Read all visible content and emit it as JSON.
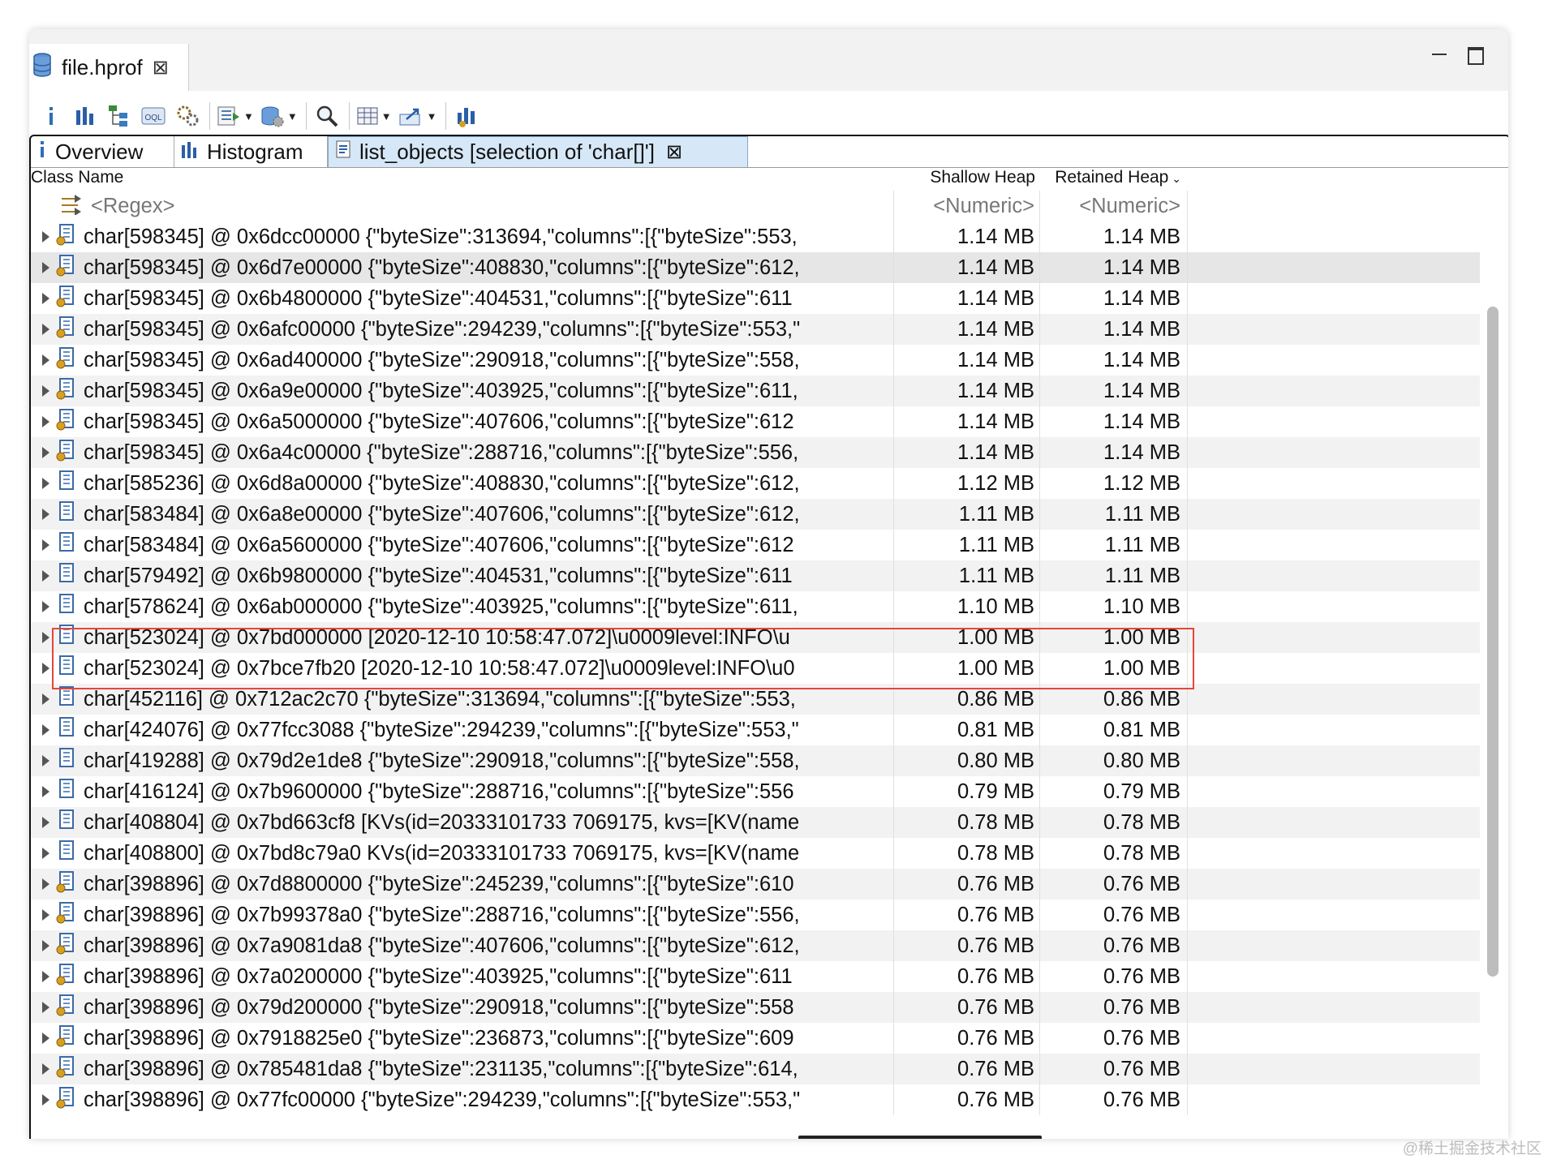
{
  "editor": {
    "tab_title": "file.hprof"
  },
  "toolbar": {
    "icons": [
      "info-icon",
      "histogram-icon",
      "dominator-tree-icon",
      "oql-icon",
      "thread-overview-icon",
      "run-report-icon",
      "query-browser-icon",
      "search-icon",
      "group-by-icon",
      "export-icon",
      "calculate-retained-icon"
    ]
  },
  "tabs": [
    {
      "label": "Overview",
      "icon": "info-icon"
    },
    {
      "label": "Histogram",
      "icon": "histogram-icon"
    },
    {
      "label": "list_objects  [selection of 'char[]']",
      "icon": "list-objects-icon",
      "closable": true
    }
  ],
  "columns": {
    "class_name": "Class Name",
    "shallow_heap": "Shallow Heap",
    "retained_heap": "Retained Heap"
  },
  "filter_row": {
    "name": "<Regex>",
    "shallow": "<Numeric>",
    "retained": "<Numeric>"
  },
  "rows": [
    {
      "name": "char[598345] @ 0x6dcc00000  {\"byteSize\":313694,\"columns\":[{\"byteSize\":553,",
      "shallow": "1.14 MB",
      "retained": "1.14 MB"
    },
    {
      "name": "char[598345] @ 0x6d7e00000  {\"byteSize\":408830,\"columns\":[{\"byteSize\":612,",
      "shallow": "1.14 MB",
      "retained": "1.14 MB"
    },
    {
      "name": "char[598345] @ 0x6b4800000  {\"byteSize\":404531,\"columns\":[{\"byteSize\":611",
      "shallow": "1.14 MB",
      "retained": "1.14 MB"
    },
    {
      "name": "char[598345] @ 0x6afc00000  {\"byteSize\":294239,\"columns\":[{\"byteSize\":553,\"",
      "shallow": "1.14 MB",
      "retained": "1.14 MB"
    },
    {
      "name": "char[598345] @ 0x6ad400000  {\"byteSize\":290918,\"columns\":[{\"byteSize\":558,",
      "shallow": "1.14 MB",
      "retained": "1.14 MB"
    },
    {
      "name": "char[598345] @ 0x6a9e00000  {\"byteSize\":403925,\"columns\":[{\"byteSize\":611,",
      "shallow": "1.14 MB",
      "retained": "1.14 MB"
    },
    {
      "name": "char[598345] @ 0x6a5000000  {\"byteSize\":407606,\"columns\":[{\"byteSize\":612",
      "shallow": "1.14 MB",
      "retained": "1.14 MB"
    },
    {
      "name": "char[598345] @ 0x6a4c00000  {\"byteSize\":288716,\"columns\":[{\"byteSize\":556,",
      "shallow": "1.14 MB",
      "retained": "1.14 MB"
    },
    {
      "name": "char[585236] @ 0x6d8a00000  {\"byteSize\":408830,\"columns\":[{\"byteSize\":612,",
      "shallow": "1.12 MB",
      "retained": "1.12 MB"
    },
    {
      "name": "char[583484] @ 0x6a8e00000  {\"byteSize\":407606,\"columns\":[{\"byteSize\":612,",
      "shallow": "1.11 MB",
      "retained": "1.11 MB"
    },
    {
      "name": "char[583484] @ 0x6a5600000  {\"byteSize\":407606,\"columns\":[{\"byteSize\":612",
      "shallow": "1.11 MB",
      "retained": "1.11 MB"
    },
    {
      "name": "char[579492] @ 0x6b9800000  {\"byteSize\":404531,\"columns\":[{\"byteSize\":611",
      "shallow": "1.11 MB",
      "retained": "1.11 MB"
    },
    {
      "name": "char[578624] @ 0x6ab000000  {\"byteSize\":403925,\"columns\":[{\"byteSize\":611,",
      "shallow": "1.10 MB",
      "retained": "1.10 MB"
    },
    {
      "name": "char[523024] @ 0x7bd000000  [2020-12-10 10:58:47.072]\\u0009level:INFO\\u",
      "shallow": "1.00 MB",
      "retained": "1.00 MB"
    },
    {
      "name": "char[523024] @ 0x7bce7fb20  [2020-12-10 10:58:47.072]\\u0009level:INFO\\u0",
      "shallow": "1.00 MB",
      "retained": "1.00 MB"
    },
    {
      "name": "char[452116] @ 0x712ac2c70  {\"byteSize\":313694,\"columns\":[{\"byteSize\":553,",
      "shallow": "0.86 MB",
      "retained": "0.86 MB"
    },
    {
      "name": "char[424076] @ 0x77fcc3088  {\"byteSize\":294239,\"columns\":[{\"byteSize\":553,\"",
      "shallow": "0.81 MB",
      "retained": "0.81 MB"
    },
    {
      "name": "char[419288] @ 0x79d2e1de8  {\"byteSize\":290918,\"columns\":[{\"byteSize\":558,",
      "shallow": "0.80 MB",
      "retained": "0.80 MB"
    },
    {
      "name": "char[416124] @ 0x7b9600000  {\"byteSize\":288716,\"columns\":[{\"byteSize\":556",
      "shallow": "0.79 MB",
      "retained": "0.79 MB"
    },
    {
      "name": "char[408804] @ 0x7bd663cf8  [KVs(id=20333101733 7069175, kvs=[KV(name",
      "shallow": "0.78 MB",
      "retained": "0.78 MB"
    },
    {
      "name": "char[408800] @ 0x7bd8c79a0  KVs(id=20333101733 7069175, kvs=[KV(name",
      "shallow": "0.78 MB",
      "retained": "0.78 MB"
    },
    {
      "name": "char[398896] @ 0x7d8800000  {\"byteSize\":245239,\"columns\":[{\"byteSize\":610",
      "shallow": "0.76 MB",
      "retained": "0.76 MB"
    },
    {
      "name": "char[398896] @ 0x7b99378a0  {\"byteSize\":288716,\"columns\":[{\"byteSize\":556,",
      "shallow": "0.76 MB",
      "retained": "0.76 MB"
    },
    {
      "name": "char[398896] @ 0x7a9081da8  {\"byteSize\":407606,\"columns\":[{\"byteSize\":612,",
      "shallow": "0.76 MB",
      "retained": "0.76 MB"
    },
    {
      "name": "char[398896] @ 0x7a0200000  {\"byteSize\":403925,\"columns\":[{\"byteSize\":611",
      "shallow": "0.76 MB",
      "retained": "0.76 MB"
    },
    {
      "name": "char[398896] @ 0x79d200000  {\"byteSize\":290918,\"columns\":[{\"byteSize\":558",
      "shallow": "0.76 MB",
      "retained": "0.76 MB"
    },
    {
      "name": "char[398896] @ 0x7918825e0  {\"byteSize\":236873,\"columns\":[{\"byteSize\":609",
      "shallow": "0.76 MB",
      "retained": "0.76 MB"
    },
    {
      "name": "char[398896] @ 0x785481da8  {\"byteSize\":231135,\"columns\":[{\"byteSize\":614,",
      "shallow": "0.76 MB",
      "retained": "0.76 MB"
    },
    {
      "name": "char[398896] @ 0x77fc00000  {\"byteSize\":294239,\"columns\":[{\"byteSize\":553,\"",
      "shallow": "0.76 MB",
      "retained": "0.76 MB"
    }
  ],
  "watermark": "@稀土掘金技术社区",
  "colors": {
    "highlight_box": "#e4473a",
    "active_tab": "#d6e8f7",
    "icon_blue": "#2f6fb5"
  }
}
